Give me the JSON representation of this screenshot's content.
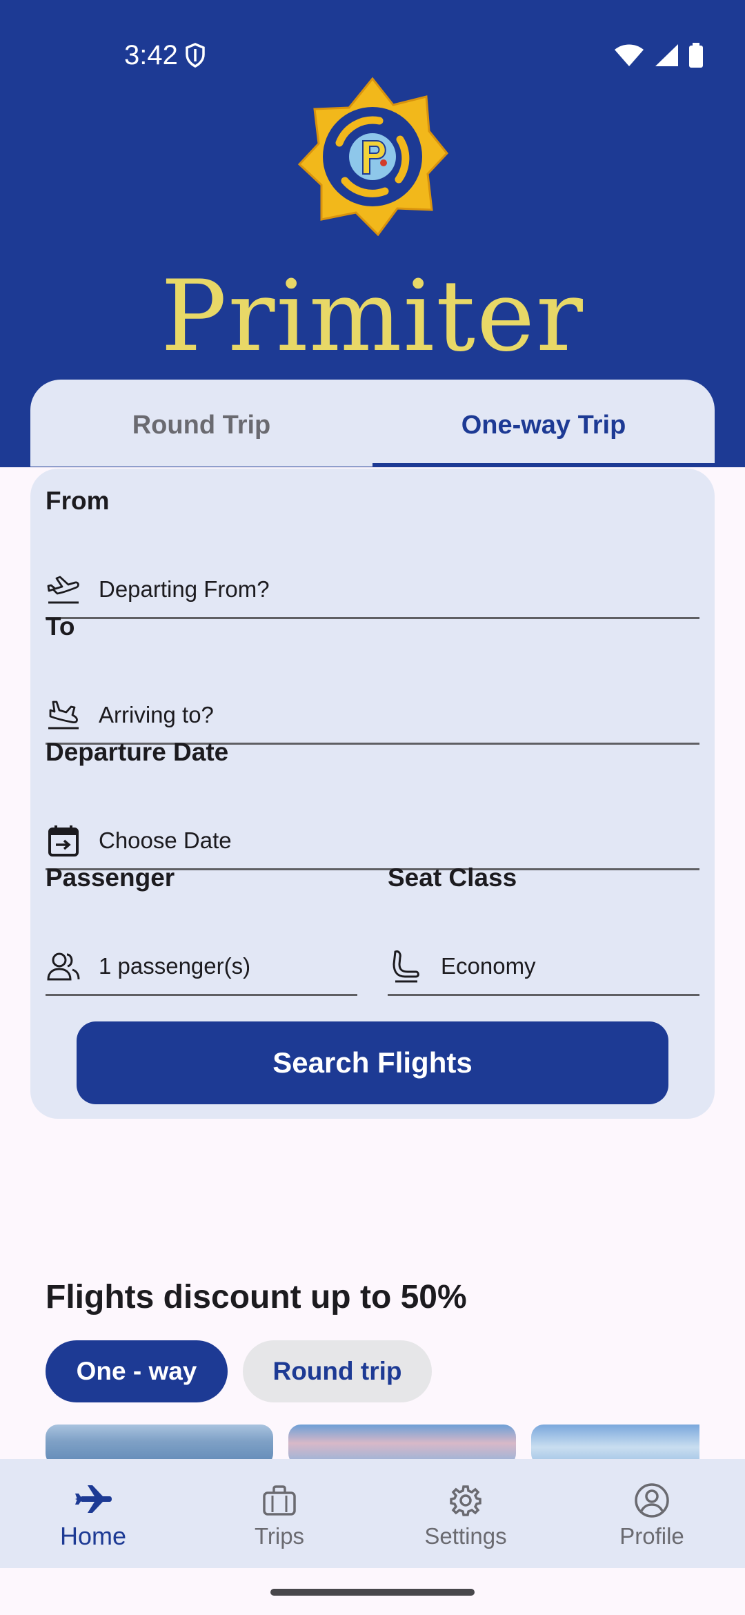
{
  "status_bar": {
    "time": "3:42"
  },
  "brand": {
    "name": "Primiter"
  },
  "trip_tabs": [
    {
      "label": "Round Trip",
      "active": false
    },
    {
      "label": "One-way Trip",
      "active": true
    }
  ],
  "form": {
    "from": {
      "label": "From",
      "placeholder": "Departing From?",
      "icon": "flight-takeoff-icon"
    },
    "to": {
      "label": "To",
      "placeholder": "Arriving to?",
      "icon": "flight-land-icon"
    },
    "departure_date": {
      "label": "Departure Date",
      "placeholder": "Choose Date",
      "icon": "calendar-icon"
    },
    "passenger": {
      "label": "Passenger",
      "value": "1 passenger(s)",
      "icon": "people-icon"
    },
    "seat_class": {
      "label": "Seat Class",
      "value": "Economy",
      "icon": "seat-icon"
    },
    "search_button": "Search Flights"
  },
  "promo": {
    "title": "Flights discount up to 50%",
    "chips": [
      {
        "label": "One - way",
        "selected": true
      },
      {
        "label": "Round trip",
        "selected": false
      }
    ]
  },
  "bottom_nav": [
    {
      "label": "Home",
      "icon": "airplane-icon",
      "active": true
    },
    {
      "label": "Trips",
      "icon": "briefcase-icon",
      "active": false
    },
    {
      "label": "Settings",
      "icon": "gear-icon",
      "active": false
    },
    {
      "label": "Profile",
      "icon": "account-circle-icon",
      "active": false
    }
  ],
  "colors": {
    "primary": "#1d3a94",
    "card": "#e2e7f5",
    "brand_text": "#e8d867",
    "background": "#fdf7fd"
  }
}
